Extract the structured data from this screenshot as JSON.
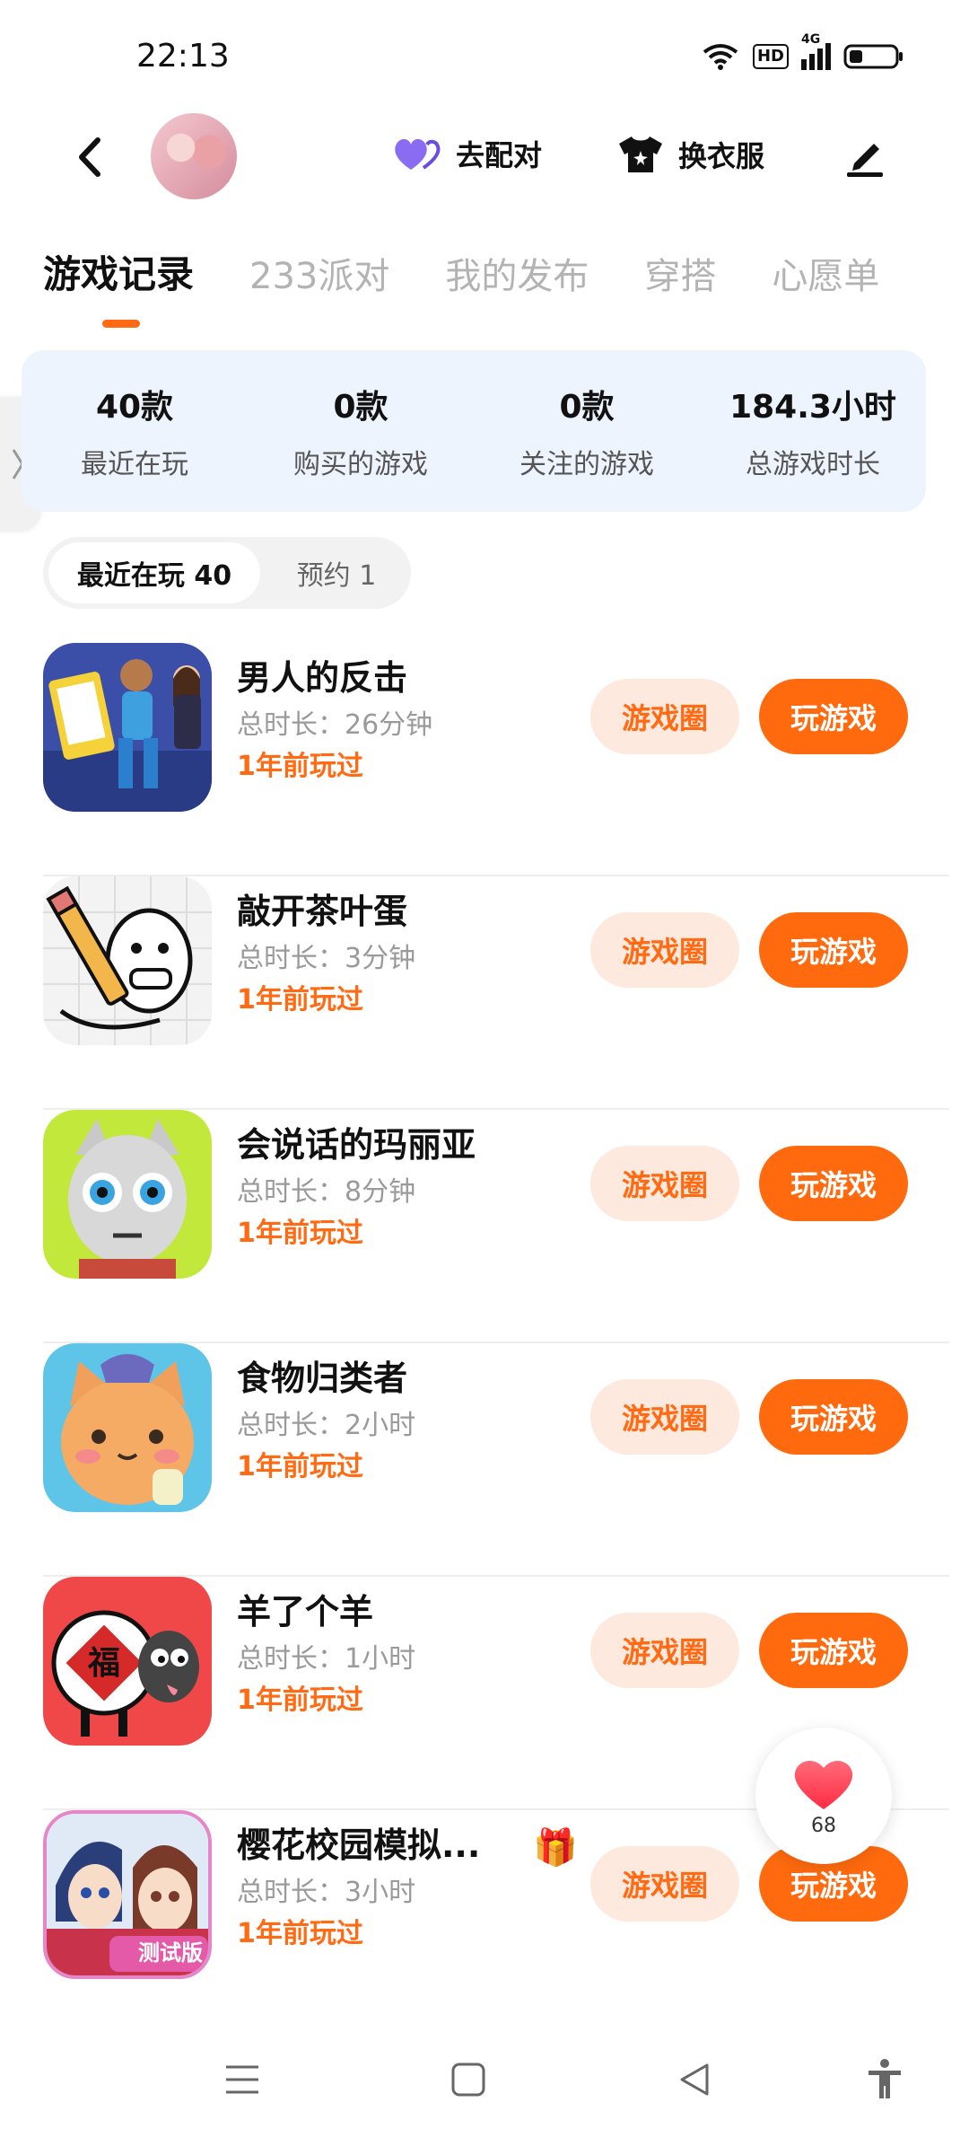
{
  "status_bar": {
    "time": "22:13",
    "network": "4G",
    "hd": "HD"
  },
  "header": {
    "match_label": "去配对",
    "dress_label": "换衣服"
  },
  "tabs": [
    {
      "label": "游戏记录"
    },
    {
      "label": "233派对"
    },
    {
      "label": "我的发布"
    },
    {
      "label": "穿搭"
    },
    {
      "label": "心愿单"
    }
  ],
  "stats": [
    {
      "value": "40款",
      "label": "最近在玩"
    },
    {
      "value": "0款",
      "label": "购买的游戏"
    },
    {
      "value": "0款",
      "label": "关注的游戏"
    },
    {
      "value": "184.3小时",
      "label": "总游戏时长"
    }
  ],
  "filters": {
    "recent": "最近在玩 40",
    "reserved": "预约 1"
  },
  "games": [
    {
      "name": "男人的反击",
      "time": "总时长：26分钟",
      "last": "1年前玩过",
      "circle": "游戏圈",
      "play": "玩游戏"
    },
    {
      "name": "敲开茶叶蛋",
      "time": "总时长：3分钟",
      "last": "1年前玩过",
      "circle": "游戏圈",
      "play": "玩游戏"
    },
    {
      "name": "会说话的玛丽亚",
      "time": "总时长：8分钟",
      "last": "1年前玩过",
      "circle": "游戏圈",
      "play": "玩游戏"
    },
    {
      "name": "食物归类者",
      "time": "总时长：2小时",
      "last": "1年前玩过",
      "circle": "游戏圈",
      "play": "玩游戏"
    },
    {
      "name": "羊了个羊",
      "time": "总时长：1小时",
      "last": "1年前玩过",
      "circle": "游戏圈",
      "play": "玩游戏"
    },
    {
      "name": "樱花校园模拟...",
      "time": "总时长：3小时",
      "last": "1年前玩过",
      "circle": "游戏圈",
      "play": "玩游戏",
      "icon_badge": "测试版"
    }
  ],
  "like": {
    "count": "68"
  },
  "colors": {
    "accent": "#ff6a13",
    "accent_light": "#fde9de",
    "stats_bg": "#eef4fd"
  }
}
